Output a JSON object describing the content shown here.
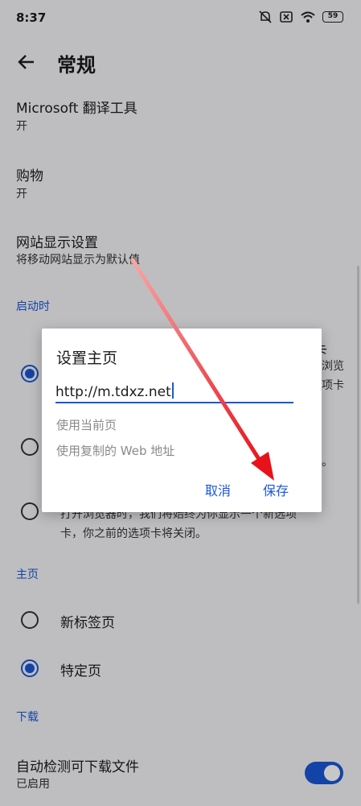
{
  "status_bar": {
    "time": "8:37",
    "battery": "59"
  },
  "header": {
    "title": "常规"
  },
  "settings": {
    "translator": {
      "title": "Microsoft 翻译工具",
      "value": "开"
    },
    "shopping": {
      "title": "购物",
      "value": "开"
    },
    "site_display": {
      "title": "网站显示设置",
      "value": "将移动网站显示为默认值"
    }
  },
  "startup": {
    "section_label": "启动时",
    "opt1_fragment_title": "卡",
    "opt1_fragment_l2": "浏览",
    "opt1_fragment_l3": "项卡",
    "opt2_fragment": "。",
    "opt3_line1": "打开浏览器时，我们将始终为你显示一个新选项",
    "opt3_line2": "卡，你之前的选项卡将关闭。"
  },
  "homepage": {
    "section_label": "主页",
    "options": [
      {
        "label": "新标签页",
        "selected": false
      },
      {
        "label": "特定页",
        "selected": true
      }
    ]
  },
  "downloads": {
    "section_label": "下载",
    "auto_detect": {
      "title": "自动检测可下载文件",
      "value": "已启用",
      "enabled": true
    }
  },
  "dialog": {
    "title": "设置主页",
    "input_value": "http://m.tdxz.net",
    "option_current": "使用当前页",
    "option_copied": "使用复制的 Web 地址",
    "cancel": "取消",
    "save": "保存"
  },
  "colors": {
    "accent": "#1a57d6",
    "annotation_arrow": "#e8121b"
  },
  "icons": [
    "back-arrow-icon",
    "mute-icon",
    "sim-off-icon",
    "wifi-icon",
    "battery-icon"
  ]
}
